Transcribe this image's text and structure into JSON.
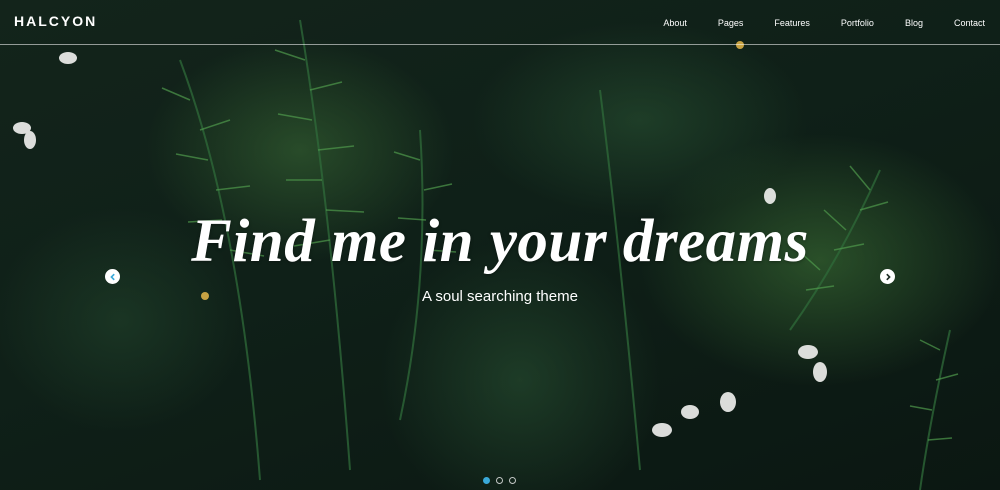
{
  "brand": {
    "logo_text": "HALCYON",
    "accent_color": "#3aa9d9"
  },
  "nav": {
    "items": [
      {
        "label": "About"
      },
      {
        "label": "Pages"
      },
      {
        "label": "Features"
      },
      {
        "label": "Portfolio"
      },
      {
        "label": "Blog"
      },
      {
        "label": "Contact"
      }
    ]
  },
  "hero": {
    "headline": "Find me in your dreams",
    "subheadline": "A soul searching theme",
    "background": "dark fern foliage with white flowers"
  },
  "slider": {
    "prev_icon": "chevron-left-icon",
    "next_icon": "chevron-right-icon",
    "slide_count": 3,
    "active_slide": 1
  }
}
